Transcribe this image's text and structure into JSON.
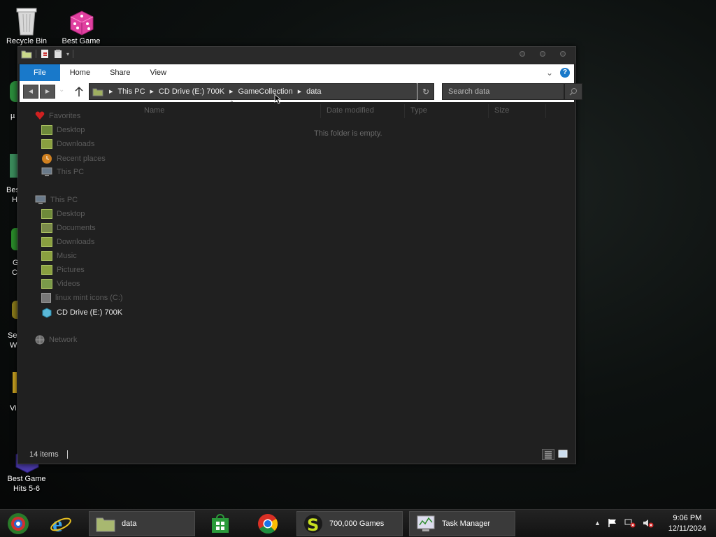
{
  "desktop": {
    "icons": [
      {
        "label": "Recycle Bin"
      },
      {
        "label": "Best Game"
      },
      {
        "label": "Best Game Hits 5-6"
      }
    ],
    "partial_labels": [
      "Best",
      "H",
      "G",
      "C",
      "Se",
      "W",
      "Vi",
      "µ"
    ]
  },
  "window": {
    "ribbon": {
      "tabs": [
        "File",
        "Home",
        "Share",
        "View"
      ]
    },
    "address": {
      "crumbs": [
        "This PC",
        "CD Drive (E:) 700K",
        "GameCollection",
        "data"
      ]
    },
    "search": {
      "placeholder": "Search data"
    },
    "nav": {
      "favorites_header": "Favorites",
      "favorites": [
        "Desktop",
        "Downloads",
        "Recent places",
        "This PC"
      ],
      "thispc_header": "This PC",
      "thispc_items": [
        "Desktop",
        "Documents",
        "Downloads",
        "Music",
        "Pictures",
        "Videos",
        "linux mint icons (C:)",
        "CD Drive (E:) 700K"
      ],
      "network": "Network"
    },
    "columns": [
      "Name",
      "Date modified",
      "Type",
      "Size"
    ],
    "empty_message": "This folder is empty.",
    "status": "14 items"
  },
  "taskbar": {
    "items": [
      "data",
      "700,000 Games",
      "Task Manager"
    ],
    "clock": {
      "time": "9:06 PM",
      "date": "12/11/2024"
    }
  },
  "colors": {
    "accent": "#1979ca",
    "window_bg": "#202020",
    "ribbon_bg": "#ffffff"
  }
}
